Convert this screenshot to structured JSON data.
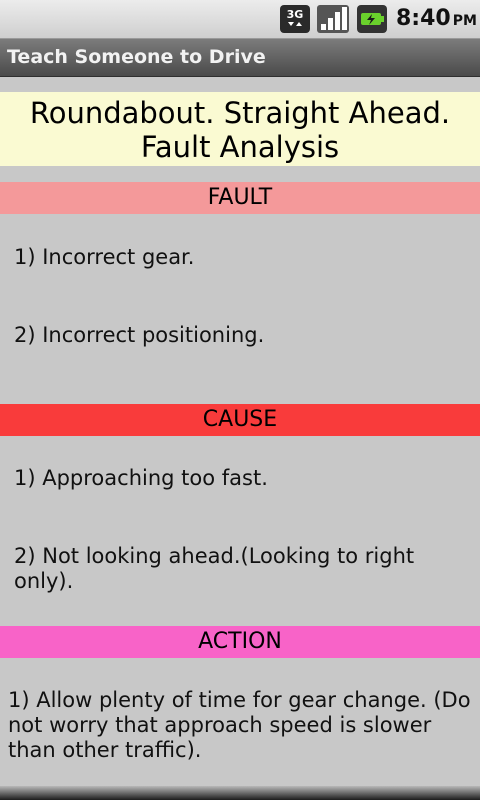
{
  "status_bar": {
    "network_label": "3G",
    "icons": [
      "network-3g-icon",
      "signal-strength-icon",
      "battery-charging-icon"
    ],
    "time": "8:40",
    "ampm": "PM"
  },
  "app": {
    "title": "Teach Someone to Drive"
  },
  "heading": {
    "line1": "Roundabout. Straight Ahead.",
    "line2": "Fault Analysis"
  },
  "sections": {
    "fault": {
      "label": "FAULT",
      "color": "#f4999a",
      "items": [
        "1) Incorrect gear.",
        "2) Incorrect positioning."
      ]
    },
    "cause": {
      "label": "CAUSE",
      "color": "#f93b3b",
      "items": [
        "1) Approaching too fast.",
        "2) Not looking ahead.(Looking to right only)."
      ]
    },
    "action": {
      "label": "ACTION",
      "color": "#f863c8",
      "items": [
        "1) Allow plenty of time for gear change. (Do not worry that approach speed is slower than other traffic)."
      ]
    }
  },
  "colors": {
    "background": "#c8c8c8",
    "heading_bg": "#fafad2",
    "titlebar": "#5e5e5e"
  }
}
